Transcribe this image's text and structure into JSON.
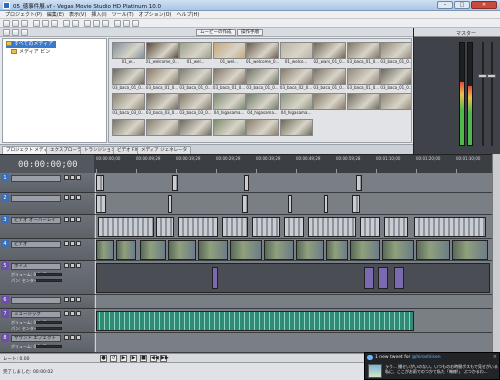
{
  "window": {
    "title": "05_徳事件展.vf - Vegas Movie Studio HD Platinum 10.0",
    "minimize": "–",
    "maximize": "□",
    "close": "✕"
  },
  "menu": [
    "プロジェクト(P)",
    "編集(E)",
    "表示(V)",
    "挿入(I)",
    "ツール(T)",
    "オプション(O)",
    "ヘルプ(H)"
  ],
  "explorer": {
    "toolbar_buttons": [
      "ムービーの作成",
      "操作手順"
    ],
    "tree": [
      {
        "label": "すべてのメディア",
        "selected": true
      },
      {
        "label": "メディア ビン",
        "selected": false
      }
    ],
    "thumbnails": [
      {
        "caption": "01_w...",
        "tone": "#7d8f9c"
      },
      {
        "caption": "01_welcome_0...",
        "tone": "#5b4a3a"
      },
      {
        "caption": "01_wel...",
        "tone": "#9aa08a"
      },
      {
        "caption": "01_wel...",
        "tone": "#c6a77a"
      },
      {
        "caption": "01_welcome_0...",
        "tone": "#6b5d4f"
      },
      {
        "caption": "01_welco...",
        "tone": "#b7b4a6"
      },
      {
        "caption": "02_wars_01_0...",
        "tone": "#6f6655"
      },
      {
        "caption": "03_baca_01_0...",
        "tone": "#807666"
      },
      {
        "caption": "03_baca_01_0...",
        "tone": "#908879"
      },
      {
        "caption": "03_baca_01_0...",
        "tone": "#6c6a60"
      },
      {
        "caption": "03_baca_01_0...",
        "tone": "#8a7b65"
      },
      {
        "caption": "03_baca_01_0...",
        "tone": "#7b7f70"
      },
      {
        "caption": "03_baca_01_0...",
        "tone": "#837466"
      },
      {
        "caption": "03_baca_01_0...",
        "tone": "#6f7467"
      },
      {
        "caption": "03_baca_02_0...",
        "tone": "#877b69"
      },
      {
        "caption": "03_baca_01_0...",
        "tone": "#7a7466"
      },
      {
        "caption": "03_baca_01_0...",
        "tone": "#938a79"
      },
      {
        "caption": "03_baca_01_0...",
        "tone": "#6c675d"
      },
      {
        "caption": "03_baca_03_0...",
        "tone": "#8b8574"
      },
      {
        "caption": "03_baca_03_0...",
        "tone": "#726c5e"
      },
      {
        "caption": "03_baca_03_0...",
        "tone": "#857d6d"
      },
      {
        "caption": "04_higasama...",
        "tone": "#7c8a74"
      },
      {
        "caption": "04_higasama...",
        "tone": "#6e7d6a"
      },
      {
        "caption": "04_higasama...",
        "tone": "#8d9580"
      },
      {
        "caption": "",
        "tone": "#867a68"
      },
      {
        "caption": "",
        "tone": "#706c60"
      },
      {
        "caption": "",
        "tone": "#8e8774"
      },
      {
        "caption": "",
        "tone": "#7a7569"
      },
      {
        "caption": "",
        "tone": "#857f70"
      },
      {
        "caption": "",
        "tone": "#6f6a5f"
      },
      {
        "caption": "",
        "tone": "#7e8a6f"
      },
      {
        "caption": "",
        "tone": "#8b7f6d"
      },
      {
        "caption": "",
        "tone": "#6a6b58"
      }
    ]
  },
  "mixer": {
    "title": "マスター",
    "meters": [
      {
        "level": 0.62
      },
      {
        "level": 0.58
      }
    ]
  },
  "tabs": [
    "プロジェクト メディア",
    "エクスプローラ",
    "トランジション",
    "ビデオ FX",
    "メディア ジェネレータ"
  ],
  "timeline": {
    "timecode": "00:00:00;00",
    "ruler_labels": [
      "00:00:00;00",
      "00:00:09;29",
      "00:00:19;29",
      "00:00:29;29",
      "00:00:39;29",
      "00:00:49;29",
      "00:00:59;28",
      "00:01:10;00",
      "00:01:20;00",
      "00:01:30;00"
    ],
    "tracks": [
      {
        "num": "1",
        "name": "",
        "kind": "text",
        "color": "#3d6fb5",
        "sub": []
      },
      {
        "num": "2",
        "name": "",
        "kind": "video",
        "color": "#3d6fb5",
        "sub": []
      },
      {
        "num": "3",
        "name": "ビデオ オーバーレイ",
        "kind": "video",
        "color": "#3d6fb5",
        "sub": []
      },
      {
        "num": "4",
        "name": "ビデオ",
        "kind": "photo",
        "color": "#3d6fb5",
        "sub": []
      },
      {
        "num": "5",
        "name": "ボイス",
        "kind": "audio",
        "color": "#6b4fa8",
        "sub": [
          "ボリューム: 0.0 dB",
          "パン: センター"
        ]
      },
      {
        "num": "6",
        "name": "",
        "kind": "empty",
        "color": "#6b4fa8",
        "sub": []
      },
      {
        "num": "7",
        "name": "ミュージック",
        "kind": "music",
        "color": "#6b4fa8",
        "sub": [
          "ボリューム: 0.0 dB",
          "パン: センター"
        ]
      },
      {
        "num": "8",
        "name": "サウンド エフェクト",
        "kind": "empty",
        "color": "#6b4fa8",
        "sub": [
          "ボリューム: 0.0 dB"
        ]
      }
    ]
  },
  "transport": {
    "rate_label": "レート: 0.00",
    "buttons": [
      "●",
      "↺",
      "▶",
      "▶",
      "■",
      "◀◀",
      "▶▶"
    ]
  },
  "status": {
    "text": "完了しました: 00:00:02"
  },
  "notification": {
    "header_prefix": "1 new tweet for",
    "header_user": "@hiroshiisen",
    "body": "ラう... 撮せいがいのない。いつものお時間ボスもで見せがいる私に、ここがお雨でのつかて私た「俺様!」 ぶつかるわ..."
  }
}
